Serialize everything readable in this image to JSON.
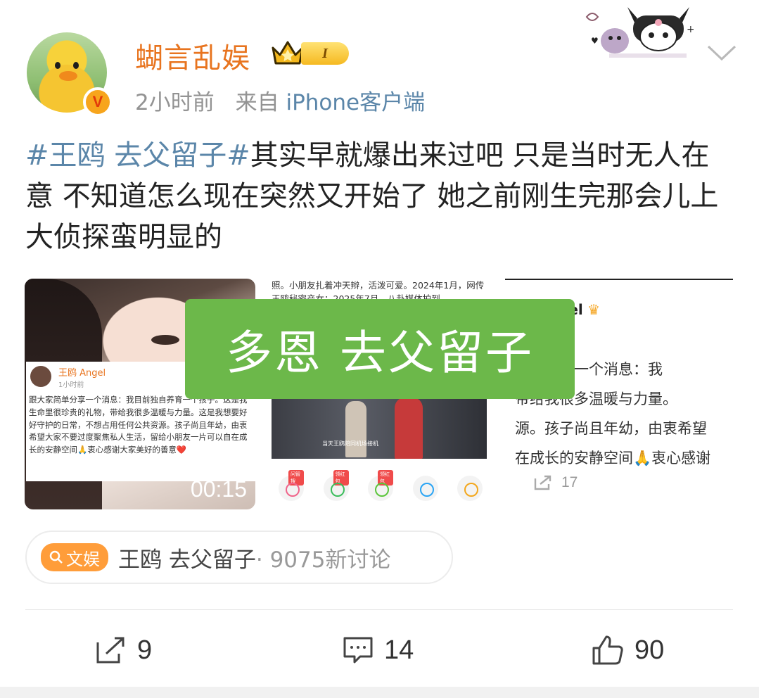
{
  "post": {
    "username": "蝴言乱娱",
    "level_badge": "I",
    "time": "2小时前",
    "source_prefix": "来自",
    "source": "iPhone客户端",
    "hashtag": "#王鸥 去父留子#",
    "text": "其实早就爆出来过吧 只是当时无人在意 不知道怎么现在突然又开始了 她之前刚生完那会儿上大侦探蛮明显的"
  },
  "media": {
    "video_card": {
      "author": "王鸥 Angel",
      "time": "1小时前",
      "text": "跟大家简单分享一个消息：我目前独自养育一个孩子。这是我生命里很珍贵的礼物，带给我很多温暖与力量。这是我想要好好守护的日常，不想占用任何公共资源。孩子尚且年幼，由衷希望大家不要过度聚焦私人生活，留给小朋友一片可以自在成长的安静空间🙏衷心感谢大家美好的善意❤️",
      "duration": "00:15"
    },
    "article_snippet": {
      "text": "照。小朋友扎着冲天辫，活泼可爱。2024年1月，网传王鸥秘密产女；2025年7月，八卦媒体拍到",
      "caption": "当天王鸥陪同机场接机",
      "icon_labels": [
        "问智搜",
        "领红包",
        "领红包"
      ]
    },
    "zoom_card": {
      "author_partial": "gel",
      "text": "简单分享一个消息：我\n带给我很多温暖与力量。\n源。孩子尚且年幼，由衷希望\n在成长的安静空间🙏衷心感谢",
      "share_count": "17"
    },
    "overlay_text": "多恩 去父留子"
  },
  "topic": {
    "chip": "文娱",
    "name": "王鸥 去父留子",
    "count": " · 9075新讨论"
  },
  "actions": {
    "repost": "9",
    "comment": "14",
    "like": "90"
  },
  "colors": {
    "username": "#e8741f",
    "link": "#5b86a9",
    "overlay": "#6cb84a",
    "chip": "#ff9d3a"
  }
}
